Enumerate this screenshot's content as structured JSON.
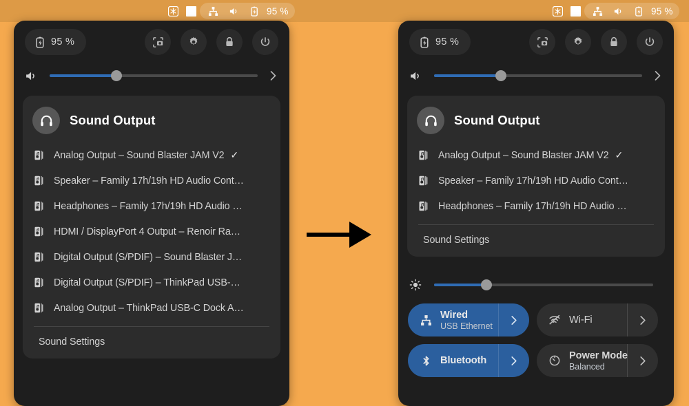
{
  "topbar": {
    "left_group": {
      "icons": [
        "snowflake-icon",
        "white-square-icon"
      ],
      "pill": {
        "icons": [
          "network-wired-icon",
          "volume-icon",
          "battery-charging-icon"
        ],
        "battery": "95 %"
      }
    },
    "right_group": {
      "icons": [
        "snowflake-icon",
        "white-square-icon"
      ],
      "pill": {
        "icons": [
          "network-wired-icon",
          "volume-icon",
          "battery-charging-icon"
        ],
        "battery": "95 %"
      }
    }
  },
  "colors": {
    "desktop": "#f5a94e",
    "topbar": "#dd9a46",
    "panel": "#1e1e1e",
    "card": "#2c2c2c",
    "accent": "#2f6cb5",
    "tile_active": "#2b5f9e"
  },
  "panel_left": {
    "header": {
      "battery": "95 %",
      "battery_icon": "battery-charging-icon",
      "buttons": [
        "screenshot-icon",
        "settings-gear-icon",
        "lock-icon",
        "power-icon"
      ]
    },
    "volume": {
      "icon": "volume-icon",
      "value": 32,
      "chevron": "chevron-right-icon"
    },
    "sound_output": {
      "icon": "headphones-icon",
      "title": "Sound Output",
      "items": [
        {
          "label": "Analog Output – Sound Blaster JAM V2",
          "selected": true
        },
        {
          "label": "Speaker – Family 17h/19h HD Audio Cont…",
          "selected": false
        },
        {
          "label": "Headphones – Family 17h/19h HD Audio …",
          "selected": false
        },
        {
          "label": "HDMI / DisplayPort 4 Output – Renoir Ra…",
          "selected": false
        },
        {
          "label": "Digital Output (S/PDIF) – Sound Blaster J…",
          "selected": false
        },
        {
          "label": "Digital Output (S/PDIF) – ThinkPad USB-…",
          "selected": false
        },
        {
          "label": "Analog Output – ThinkPad USB-C Dock A…",
          "selected": false
        }
      ],
      "check_glyph": "✓",
      "settings_label": "Sound Settings"
    }
  },
  "panel_right": {
    "header": {
      "battery": "95 %",
      "battery_icon": "battery-charging-icon",
      "buttons": [
        "screenshot-icon",
        "settings-gear-icon",
        "lock-icon",
        "power-icon"
      ]
    },
    "volume": {
      "icon": "volume-icon",
      "value": 32,
      "chevron": "chevron-right-icon"
    },
    "sound_output": {
      "icon": "headphones-icon",
      "title": "Sound Output",
      "items": [
        {
          "label": "Analog Output – Sound Blaster JAM V2",
          "selected": true
        },
        {
          "label": "Speaker – Family 17h/19h HD Audio Cont…",
          "selected": false
        },
        {
          "label": "Headphones – Family 17h/19h HD Audio …",
          "selected": false
        }
      ],
      "check_glyph": "✓",
      "settings_label": "Sound Settings"
    },
    "brightness": {
      "icon": "brightness-sun-icon",
      "value": 24
    },
    "tiles": [
      {
        "name": "Wired",
        "sub": "USB Ethernet",
        "icon": "network-wired-icon",
        "active": true
      },
      {
        "name": "Wi-Fi",
        "sub": "",
        "icon": "wifi-disabled-icon",
        "active": false
      },
      {
        "name": "Bluetooth",
        "sub": "",
        "icon": "bluetooth-icon",
        "active": true
      },
      {
        "name": "Power Mode",
        "sub": "Balanced",
        "icon": "power-mode-icon",
        "active": false
      }
    ]
  },
  "annotation": {
    "arrow": "right-arrow-annotation"
  }
}
